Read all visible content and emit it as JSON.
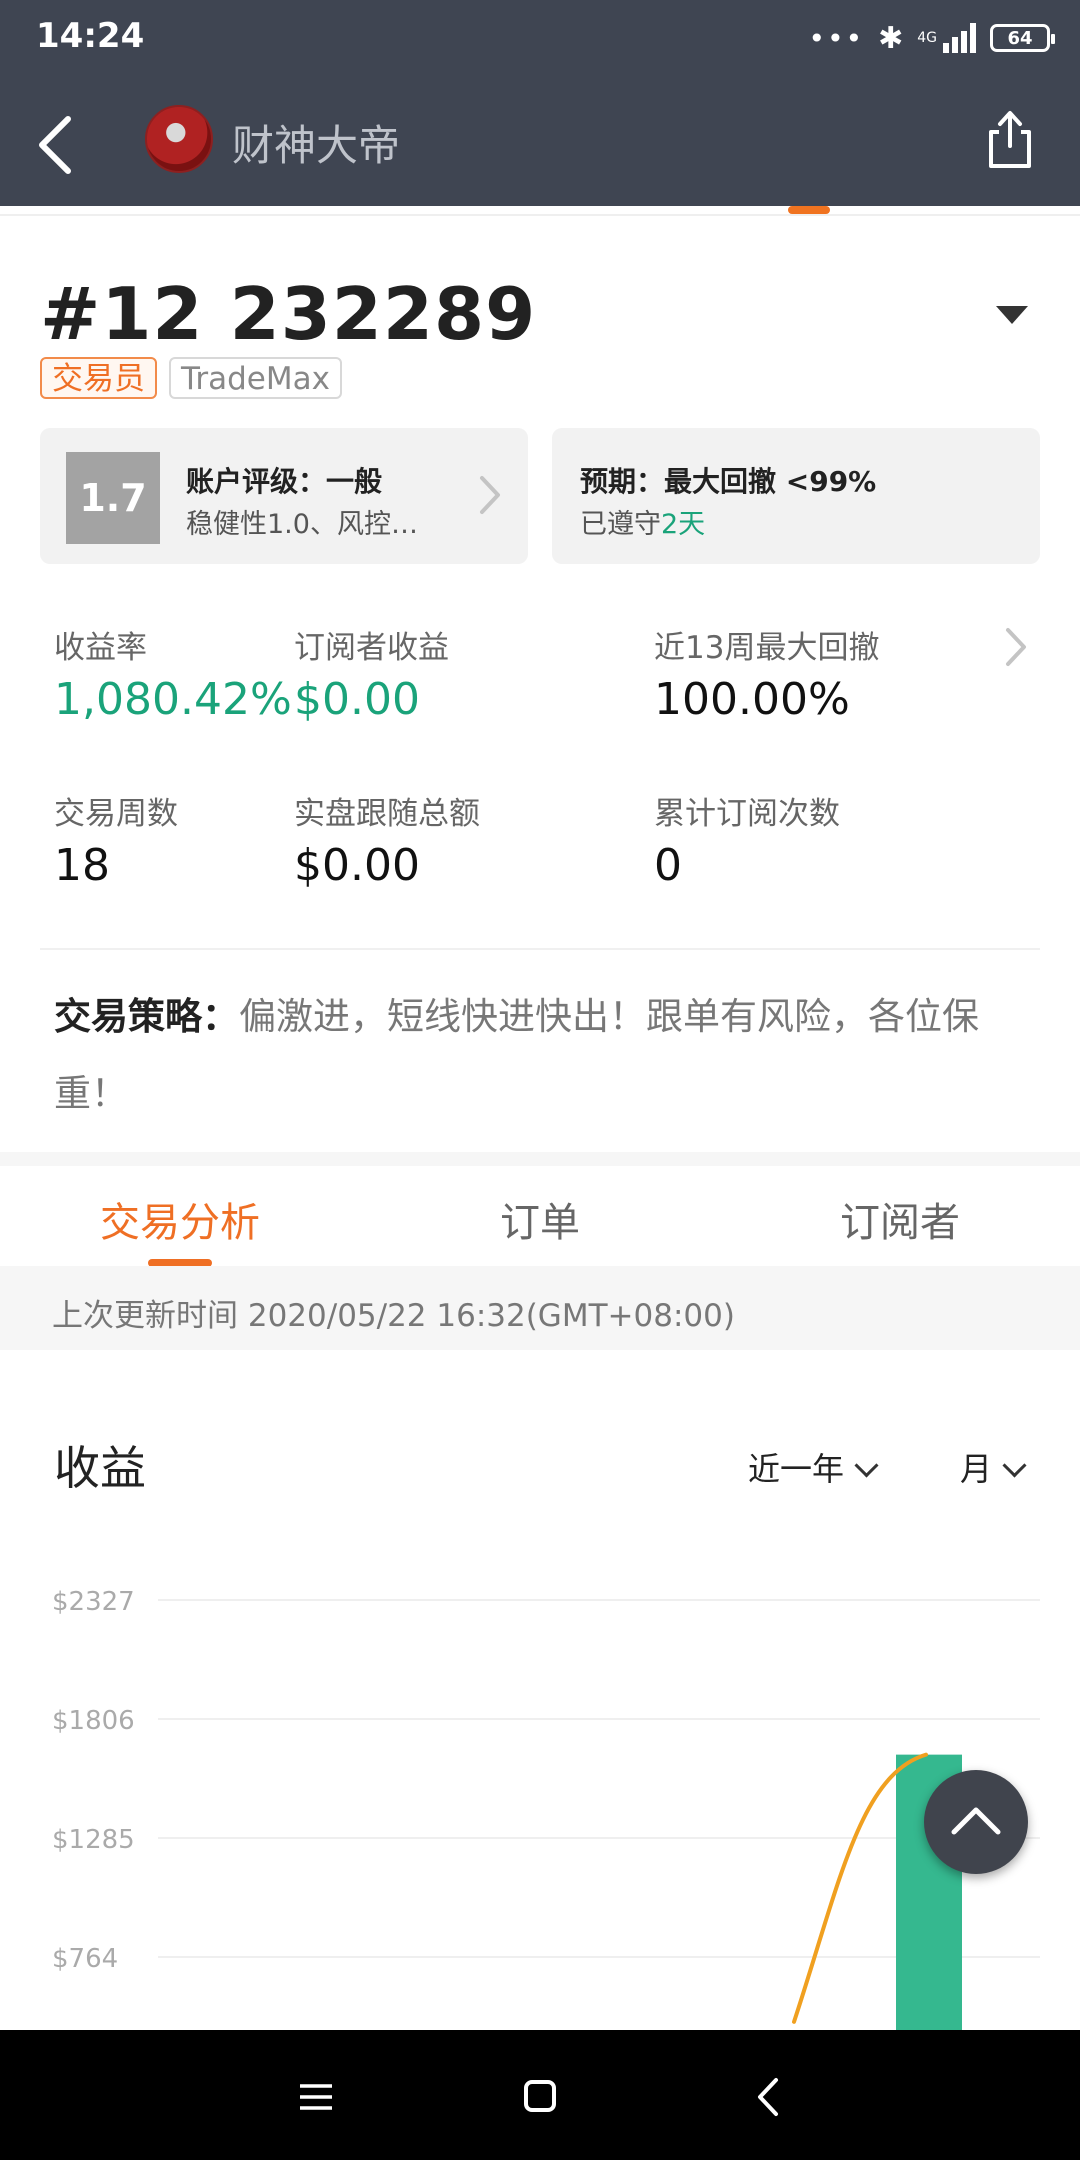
{
  "status_bar": {
    "time": "14:24",
    "network": "4G",
    "battery": "64"
  },
  "header": {
    "nickname": "财神大帝"
  },
  "trader": {
    "id": "#12 232289",
    "tags": [
      "交易员",
      "TradeMax"
    ]
  },
  "rating_card": {
    "score": "1.7",
    "title": "账户评级：一般",
    "desc": "稳健性1.0、风控…"
  },
  "expect_card": {
    "title": "预期：最大回撤 <99%",
    "desc_prefix": "已遵守",
    "desc_days": "2天"
  },
  "stats": {
    "return_rate": {
      "label": "收益率",
      "value": "1,080.42%"
    },
    "subscriber_profit": {
      "label": "订阅者收益",
      "value": "$0.00"
    },
    "max_drawdown_13w": {
      "label": "近13周最大回撤",
      "value": "100.00%"
    },
    "trading_weeks": {
      "label": "交易周数",
      "value": "18"
    },
    "live_follow_total": {
      "label": "实盘跟随总额",
      "value": "$0.00"
    },
    "total_subscriptions": {
      "label": "累计订阅次数",
      "value": "0"
    }
  },
  "strategy": {
    "label": "交易策略：",
    "text": "偏激进，短线快进快出！跟单有风险，各位保重！"
  },
  "tabs": [
    {
      "label": "交易分析",
      "active": true
    },
    {
      "label": "订单",
      "active": false
    },
    {
      "label": "订阅者",
      "active": false
    }
  ],
  "update_text": "上次更新时间 2020/05/22 16:32(GMT+08:00)",
  "chart": {
    "title": "收益",
    "range_select": "近一年",
    "period_select": "月"
  },
  "colors": {
    "accent": "#ef6f24",
    "positive": "#1aa37a",
    "bar": "#35b88f",
    "line": "#f0a020",
    "header_bg": "#3f4552"
  },
  "chart_data": {
    "type": "bar",
    "title": "收益",
    "y_ticks": [
      2327,
      1806,
      1285,
      764
    ],
    "y_tick_labels": [
      "$2327",
      "$1806",
      "$1285",
      "$764"
    ],
    "series": [
      {
        "type": "bar",
        "values": [
          1650
        ]
      },
      {
        "type": "line",
        "values": [
          480,
          1650
        ]
      }
    ],
    "grid": true
  }
}
